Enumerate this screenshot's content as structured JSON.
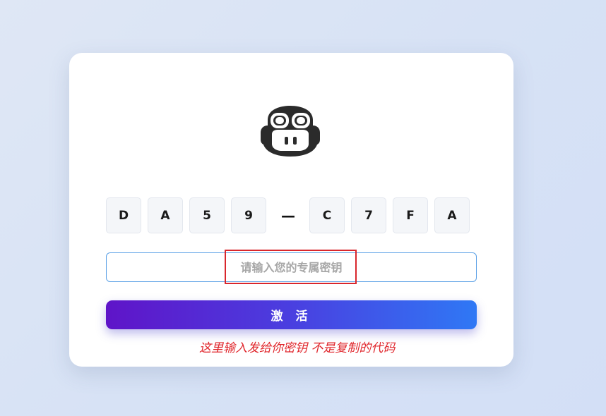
{
  "logo": {
    "icon": "copilot-icon",
    "color": "#2b2b2b"
  },
  "code": {
    "first": [
      "D",
      "A",
      "5",
      "9"
    ],
    "separator": "—",
    "second": [
      "C",
      "7",
      "F",
      "A"
    ]
  },
  "key_input": {
    "placeholder": "请输入您的专属密钥",
    "value": ""
  },
  "activate_button": {
    "label": "激 活"
  },
  "annotation": {
    "note": "这里输入发给你密钥 不是复制的代码",
    "color": "#e0262c"
  },
  "colors": {
    "button_start": "#5f14c8",
    "button_end": "#2f78f5",
    "input_border": "#5aa0e6"
  }
}
